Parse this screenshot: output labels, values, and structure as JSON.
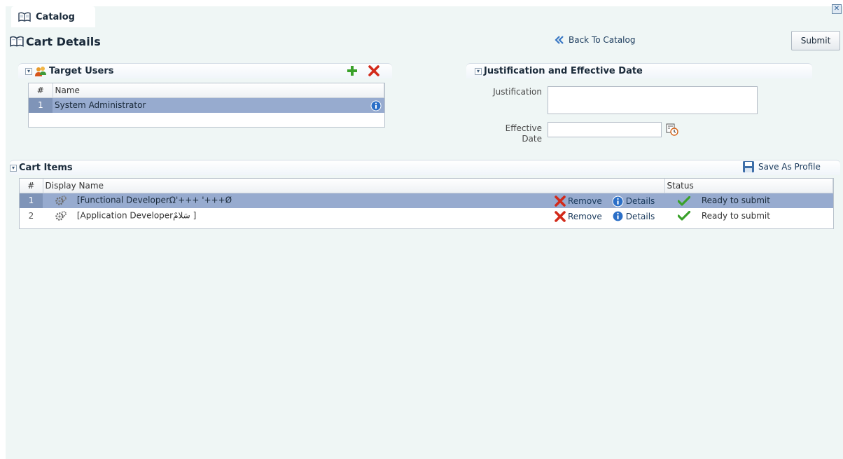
{
  "tab": {
    "label": "Catalog",
    "icon": "book-icon"
  },
  "page": {
    "title": "Cart Details",
    "icon": "book-icon"
  },
  "header": {
    "back_label": "Back To Catalog",
    "submit_label": "Submit"
  },
  "target_users": {
    "title": "Target Users",
    "columns": [
      "#",
      "Name"
    ],
    "rows": [
      {
        "num": "1",
        "name": "System Administrator"
      }
    ]
  },
  "justification": {
    "title": "Justification and Effective Date",
    "justification_label": "Justification",
    "justification_value": "",
    "effective_label_line1": "Effective",
    "effective_label_line2": "Date",
    "effective_value": ""
  },
  "cart": {
    "title": "Cart Items",
    "save_profile_label": "Save As Profile",
    "columns": [
      "#",
      "Display Name",
      "Status"
    ],
    "items": [
      {
        "num": "1",
        "name": "[Functional DeveloperΩ'+++ '+++Ø",
        "remove": "Remove",
        "details": "Details",
        "status": "Ready to submit"
      },
      {
        "num": "2",
        "name": "[Application Developerسَلامٌ ]",
        "remove": "Remove",
        "details": "Details",
        "status": "Ready to submit"
      }
    ]
  },
  "colors": {
    "background": "#eff6f5",
    "selected_row": "#97abcf",
    "selected_num": "#7f94b8",
    "link": "#1a3a5c",
    "add_green": "#3aa12a",
    "remove_red": "#d22a1a",
    "info_blue": "#2b6fc7"
  }
}
